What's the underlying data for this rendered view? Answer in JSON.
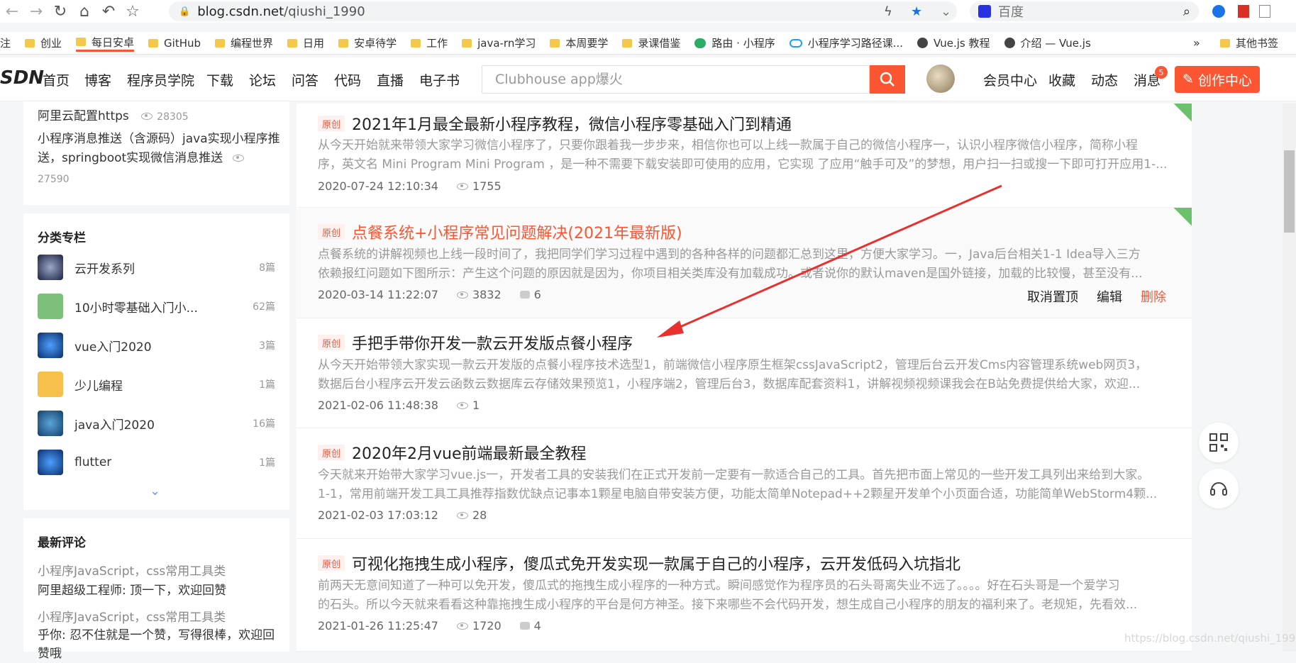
{
  "browser": {
    "url_domain": "blog.csdn.net",
    "url_path": "/qiushi_1990",
    "search_engine": "百度"
  },
  "bookmarks": {
    "cut_left": "注",
    "items": [
      "创业",
      "每日安卓",
      "GitHub",
      "编程世界",
      "日用",
      "安卓待学",
      "工作",
      "java-rn学习",
      "本周要学",
      "录课借鉴",
      "路由 · 小程序",
      "小程序学习路径课...",
      "Vue.js 教程",
      "介绍 — Vue.js"
    ],
    "more": "»",
    "other": "其他书签"
  },
  "header": {
    "logo_partial": "SDN",
    "nav": [
      "首页",
      "博客",
      "程序员学院",
      "下载",
      "论坛",
      "问答",
      "代码",
      "直播",
      "电子书"
    ],
    "search_placeholder": "Clubhouse app爆火",
    "user_links": [
      "会员中心",
      "收藏",
      "动态",
      "消息"
    ],
    "message_badge": "5",
    "create_label": "创作中心"
  },
  "sidebar": {
    "hot_articles": [
      {
        "title": "阿里云配置https",
        "views": "28305"
      },
      {
        "title": "小程序消息推送（含源码）java实现小程序推送，springboot实现微信消息推送",
        "views": "27590"
      }
    ],
    "categories_title": "分类专栏",
    "categories": [
      {
        "name": "云开发系列",
        "count": "8篇"
      },
      {
        "name": "10小时零基础入门小...",
        "count": "62篇"
      },
      {
        "name": "vue入门2020",
        "count": "3篇"
      },
      {
        "name": "少儿编程",
        "count": "1篇"
      },
      {
        "name": "java入门2020",
        "count": "16篇"
      },
      {
        "name": "flutter",
        "count": "1篇"
      }
    ],
    "comments_title": "最新评论",
    "comments": [
      {
        "article": "小程序JavaScript，css常用工具类",
        "text": "阿里超级工程师: 顶一下，欢迎回赞"
      },
      {
        "article": "小程序JavaScript，css常用工具类",
        "text": "乎你: 忍不住就是一个赞，写得很棒，欢迎回赞哦"
      }
    ]
  },
  "articles": [
    {
      "tag": "原创",
      "title": "2021年1月最全最新小程序教程，微信小程序零基础入门到精通",
      "desc1": "从今天开始就来带领大家学习微信小程序了，只要你跟着我一步步来，相信你也可以上线一款属于自己的微信小程序一，认识小程序微信小程序，简称小程",
      "desc2": "序，英文名 Mini Program Mini Program ，是一种不需要下载安装即可使用的应用，它实现 了应用“触手可及”的梦想，用户扫一扫或搜一下即可打开应用1-...",
      "date": "2020-07-24 12:10:34",
      "views": "1755",
      "comments": "",
      "pinned": true
    },
    {
      "tag": "原创",
      "title": "点餐系统+小程序常见问题解决(2021年最新版)",
      "desc1": "点餐系统的讲解视频也上线一段时间了，我把同学们学习过程中遇到的各种各样的问题都汇总到这里，方便大家学习。一，Java后台相关1-1 Idea导入三方",
      "desc2": "依赖报红问题如下图所示：产生这个问题的原因就是因为，你项目相关类库没有加载成功。或者说你的默认maven是国外链接，加载的比较慢，甚至没有...",
      "date": "2020-03-14 11:22:07",
      "views": "3832",
      "comments": "6",
      "pinned": true,
      "actions": [
        "取消置顶",
        "编辑",
        "删除"
      ]
    },
    {
      "tag": "原创",
      "title": "手把手带你开发一款云开发版点餐小程序",
      "desc1": "从今天开始带领大家实现一款云开发版的点餐小程序技术选型1，前端微信小程序原生框架cssJavaScript2，管理后台云开发Cms内容管理系统web网页3，",
      "desc2": "数据后台小程序云开发云函数云数据库云存储效果预览1，小程序端2，管理后台3，数据库配套资料1，讲解视频视频课我会在B站免费提供给大家，欢迎...",
      "date": "2021-02-06 11:48:38",
      "views": "1",
      "comments": ""
    },
    {
      "tag": "原创",
      "title": "2020年2月vue前端最新最全教程",
      "desc1": "今天就来开始带大家学习vue.js一，开发者工具的安装我们在正式开发前一定要有一款适合自己的工具。首先把市面上常见的一些开发工具列出来给到大家。",
      "desc2": "1-1，常用前端开发工具工具推荐指数优缺点记事本1颗星电脑自带安装方便，功能太简单Notepad++2颗星开发单个小页面合适，功能简单WebStorm4颗...",
      "date": "2021-02-03 17:03:12",
      "views": "28",
      "comments": ""
    },
    {
      "tag": "原创",
      "title": "可视化拖拽生成小程序，傻瓜式免开发实现一款属于自己的小程序，云开发低码入坑指北",
      "desc1": "前两天无意间知道了一种可以免开发，傻瓜式的拖拽生成小程序的一种方式。瞬间感觉作为程序员的石头哥离失业不远了。。。。好在石头哥是一个爱学习",
      "desc2": "的石头。所以今天就来看看这种靠拖拽生成小程序的平台是何方神圣。接下来哪些不会代码开发，想生成自己小程序的朋友的福利来了。老规矩，先看效...",
      "date": "2021-01-26 11:25:47",
      "views": "1720",
      "comments": "4"
    }
  ],
  "watermark": "https://blog.csdn.net/qiushi_1990",
  "colors": {
    "accent": "#fc5531",
    "arrow": "#e8312f"
  }
}
